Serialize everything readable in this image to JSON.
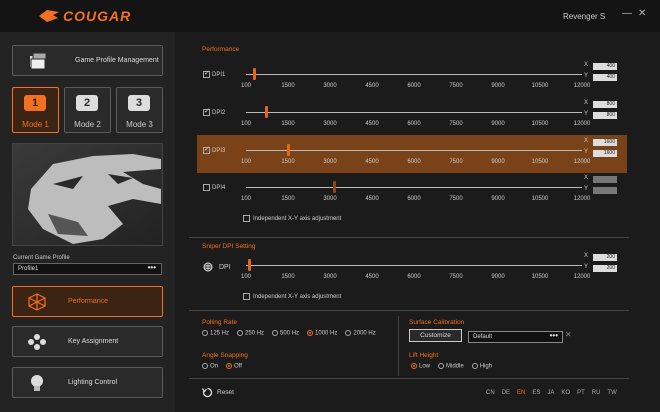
{
  "app": {
    "brand": "COUGAR",
    "title": "Revenger S",
    "minimize": "—",
    "close": "✕"
  },
  "sidebar": {
    "game_profile_management": "Game Profile Management",
    "modes": [
      {
        "num": "1",
        "label": "Mode 1"
      },
      {
        "num": "2",
        "label": "Mode 2"
      },
      {
        "num": "3",
        "label": "Mode 3"
      }
    ],
    "current_profile_label": "Current Game Profile",
    "current_profile_value": "Profile1",
    "more": "•••",
    "nav": [
      {
        "label": "Performance",
        "icon": "performance-cube-icon"
      },
      {
        "label": "Key Assignment",
        "icon": "key-assignment-icon"
      },
      {
        "label": "Lighting Control",
        "icon": "lightbulb-icon"
      }
    ]
  },
  "performance": {
    "title": "Performance",
    "ticks": [
      "100",
      "1500",
      "3000",
      "4500",
      "6000",
      "7500",
      "9000",
      "10500",
      "12000"
    ],
    "rows": [
      {
        "label": "DPI1",
        "checked": true,
        "x": "400",
        "y": "400",
        "value": 400
      },
      {
        "label": "DPI2",
        "checked": true,
        "x": "800",
        "y": "800",
        "value": 800
      },
      {
        "label": "DPI3",
        "checked": true,
        "x": "1600",
        "y": "1600",
        "value": 1600
      },
      {
        "label": "DPI4",
        "checked": false,
        "x": "3200",
        "y": "3200",
        "value": 3200
      }
    ],
    "independent": "Independent X-Y axis adjustment"
  },
  "sniper": {
    "title": "Sniper DPI Setting",
    "label": "DPI",
    "x": "200",
    "y": "200",
    "value": 200,
    "independent": "Independent X-Y axis adjustment"
  },
  "xy": {
    "x": "X",
    "y": "Y"
  },
  "polling": {
    "title": "Polling Rate",
    "options": [
      "125 Hz",
      "250 Hz",
      "500 Hz",
      "1000 Hz",
      "2000 Hz"
    ],
    "selected": "1000 Hz"
  },
  "angle": {
    "title": "Angle Snapping",
    "options": [
      "On",
      "Off"
    ],
    "selected": "Off"
  },
  "surface": {
    "title": "Surface Calibration",
    "button": "Customize",
    "value": "Default",
    "more": "•••",
    "clear": "✕"
  },
  "lift": {
    "title": "Lift Height",
    "options": [
      "Low",
      "Middle",
      "High"
    ],
    "selected": "Low"
  },
  "footer": {
    "reset": "Reset",
    "languages": [
      "CN",
      "DE",
      "EN",
      "ES",
      "JA",
      "KO",
      "PT",
      "RU",
      "TW"
    ],
    "selected_language": "EN"
  },
  "colors": {
    "accent": "#f37021",
    "highlight": "#7a4218",
    "bg": "#1b1b1b"
  }
}
